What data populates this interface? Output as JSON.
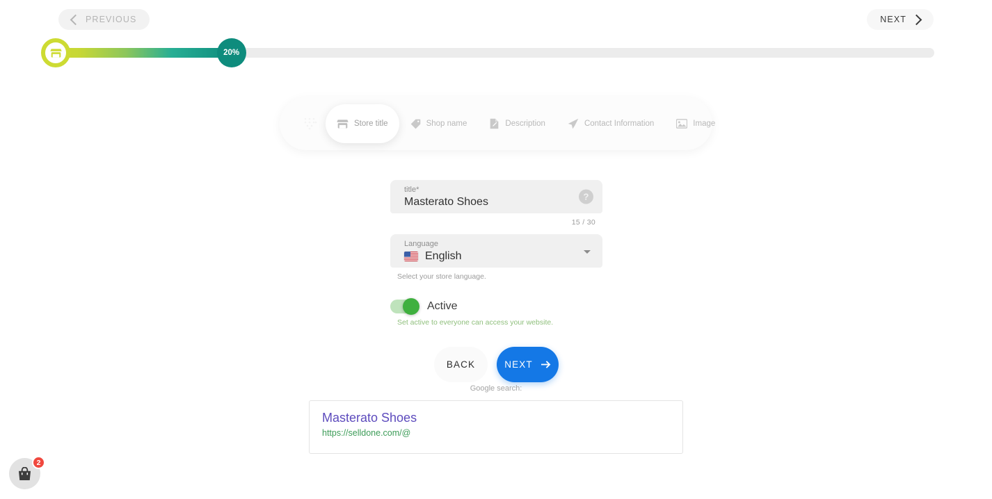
{
  "topnav": {
    "previous_label": "PREVIOUS",
    "next_label": "NEXT",
    "prev_icon": "chevron-left-icon",
    "next_icon": "chevron-right-icon"
  },
  "progress": {
    "percent_label": "20%",
    "percent_value": 20,
    "start_icon": "store-icon",
    "gradient_start": "#cddb33",
    "gradient_end": "#0f8d7e",
    "track_color": "#ececec"
  },
  "steps": [
    {
      "label": "",
      "icon": "dots-pattern-icon",
      "active": false,
      "ghost": true
    },
    {
      "label": "Store title",
      "icon": "store-icon",
      "active": true,
      "ghost": false
    },
    {
      "label": "Shop name",
      "icon": "tag-icon",
      "active": false,
      "ghost": false
    },
    {
      "label": "Description",
      "icon": "document-edit-icon",
      "active": false,
      "ghost": false
    },
    {
      "label": "Contact Information",
      "icon": "paper-plane-icon",
      "active": false,
      "ghost": false
    },
    {
      "label": "Image",
      "icon": "image-icon",
      "active": false,
      "ghost": false
    }
  ],
  "form": {
    "title_field": {
      "label": "title*",
      "value": "Masterato Shoes",
      "counter": "15 / 30",
      "help_icon": "question-mark-icon"
    },
    "language_field": {
      "label": "Language",
      "value": "English",
      "flag": "us-flag-icon",
      "caret_icon": "caret-down-icon",
      "hint": "Select your store language."
    },
    "active_toggle": {
      "label": "Active",
      "enabled": true,
      "hint": "Set active to everyone can access your website.",
      "on_color": "#3fb03f"
    },
    "buttons": {
      "back_label": "BACK",
      "next_label": "NEXT",
      "next_icon": "arrow-right-icon",
      "next_color": "#1478e6"
    }
  },
  "google_preview": {
    "caption": "Google search:",
    "title": "Masterato Shoes",
    "url": "https://selldone.com/@",
    "title_color": "#5d4bbd",
    "url_color": "#3d9c58"
  },
  "cart": {
    "icon": "shopping-bag-icon",
    "badge_count": "2",
    "badge_color": "#f0483e"
  }
}
